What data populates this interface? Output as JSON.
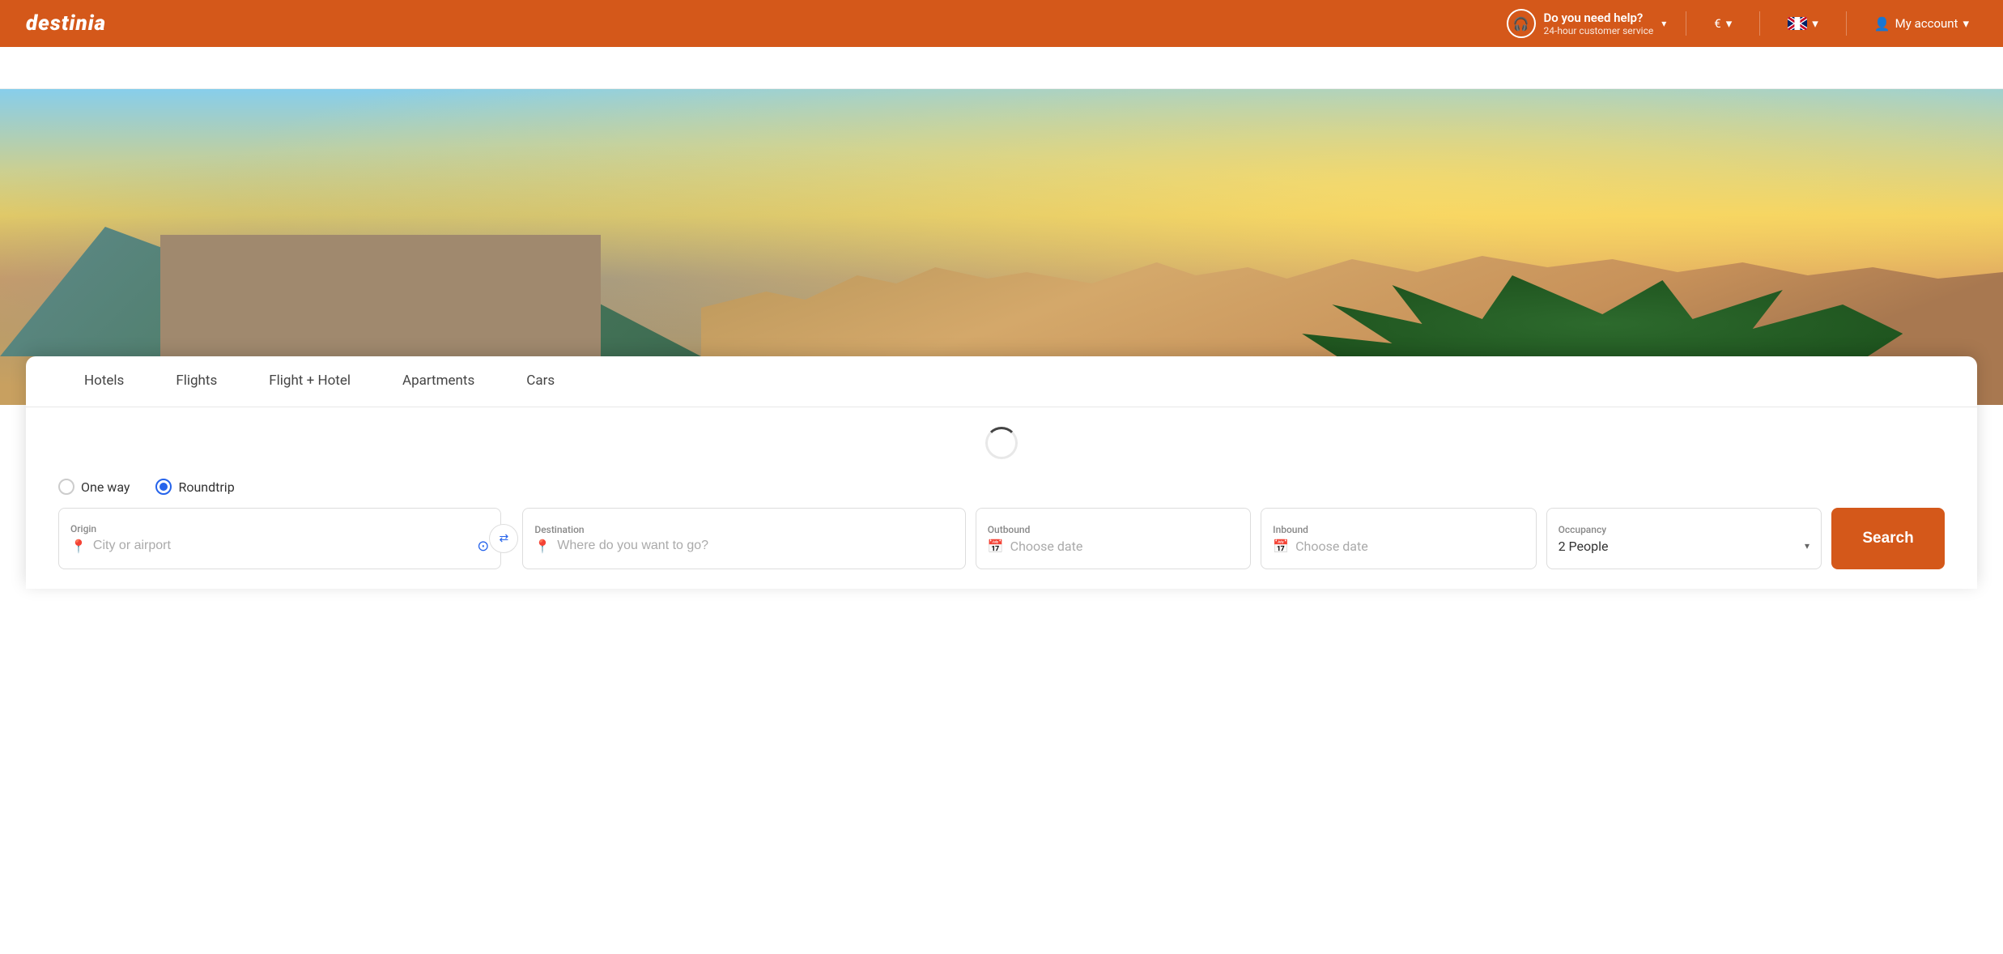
{
  "brand": {
    "logo": "DESTINIA"
  },
  "topnav": {
    "help_title": "Do you need help?",
    "help_sub": "24-hour customer service",
    "help_chevron": "▾",
    "currency": "€",
    "currency_chevron": "▾",
    "language_chevron": "▾",
    "account_label": "My account",
    "account_chevron": "▾"
  },
  "subnav": {},
  "tabs": [
    {
      "label": "Hotels",
      "active": false
    },
    {
      "label": "Flights",
      "active": false
    },
    {
      "label": "Flight + Hotel",
      "active": false
    },
    {
      "label": "Apartments",
      "active": false
    },
    {
      "label": "Cars",
      "active": false
    }
  ],
  "trip_type": [
    {
      "label": "One way",
      "checked": false
    },
    {
      "label": "Roundtrip",
      "checked": true
    }
  ],
  "fields": {
    "origin_label": "Origin",
    "origin_placeholder": "City or airport",
    "destination_label": "Destination",
    "destination_placeholder": "Where do you want to go?",
    "outbound_label": "Outbound",
    "outbound_placeholder": "Choose date",
    "inbound_label": "Inbound",
    "inbound_placeholder": "Choose date",
    "occupancy_label": "Occupancy",
    "occupancy_value": "2 People"
  },
  "search_button_label": "Search",
  "icons": {
    "location": "📍",
    "location_blue": "⊙",
    "calendar": "📅",
    "swap": "⇄",
    "person": "👤",
    "help_headset": "🎧"
  }
}
